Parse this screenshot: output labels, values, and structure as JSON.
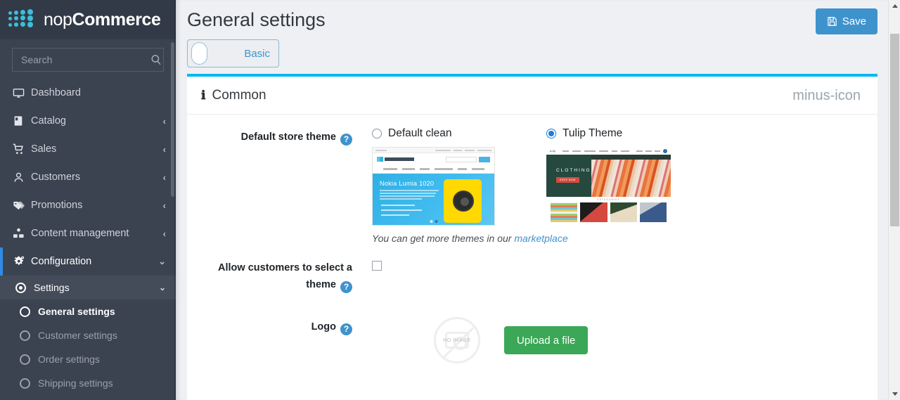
{
  "brand": {
    "name_light": "nop",
    "name_bold": "Commerce",
    "logo_icon": "nopcommerce-dots-logo"
  },
  "search": {
    "placeholder": "Search",
    "value": "",
    "icon": "search-icon"
  },
  "sidebar": {
    "items": [
      {
        "label": "Dashboard",
        "icon": "monitor-icon",
        "caret": ""
      },
      {
        "label": "Catalog",
        "icon": "book-icon",
        "caret": "‹"
      },
      {
        "label": "Sales",
        "icon": "shopping-cart-icon",
        "caret": "‹"
      },
      {
        "label": "Customers",
        "icon": "user-icon",
        "caret": "‹"
      },
      {
        "label": "Promotions",
        "icon": "tags-icon",
        "caret": "‹"
      },
      {
        "label": "Content management",
        "icon": "content-blocks-icon",
        "caret": "‹"
      },
      {
        "label": "Configuration",
        "icon": "gears-icon",
        "caret": "⌄"
      }
    ],
    "settings": {
      "label": "Settings",
      "icon": "radio-selected-icon",
      "caret": "⌄"
    },
    "settings_children": [
      {
        "label": "General settings",
        "icon": "circle-icon",
        "current": true
      },
      {
        "label": "Customer settings",
        "icon": "circle-icon",
        "current": false
      },
      {
        "label": "Order settings",
        "icon": "circle-icon",
        "current": false
      },
      {
        "label": "Shipping settings",
        "icon": "circle-icon",
        "current": false
      }
    ]
  },
  "header": {
    "title": "General settings",
    "save_label": "Save",
    "save_icon": "floppy-disk-icon",
    "save_color": "#3f93cd"
  },
  "mode_toggle": {
    "label": "Basic",
    "state": "off",
    "accent": "#3f93cd"
  },
  "panel": {
    "title": "Common",
    "title_icon": "info-icon",
    "collapse_icon": "minus-icon",
    "accent": "#00b9f1"
  },
  "form": {
    "default_store_theme": {
      "label": "Default store theme",
      "hint_icon": "question-mark-icon",
      "options": [
        {
          "name": "Default clean",
          "selected": false,
          "preview": "nokia-lumia-1020-storefront-preview"
        },
        {
          "name": "Tulip Theme",
          "selected": true,
          "preview": "clothing-storefront-preview"
        }
      ],
      "note_text": "You can get more themes in our ",
      "note_link": "marketplace"
    },
    "allow_select_theme": {
      "label": "Allow customers to select a theme",
      "hint_icon": "question-mark-icon",
      "checked": false
    },
    "logo": {
      "label": "Logo",
      "hint_icon": "question-mark-icon",
      "placeholder_text": "NO IMAGE",
      "placeholder_icon": "no-image-camera-icon",
      "upload_label": "Upload a file",
      "upload_color": "#3aa856"
    }
  },
  "preview_default_clean": {
    "hero_title": "Nokia Lumia 1020",
    "logo_text": "nopCommerce"
  },
  "preview_tulip": {
    "logo_text": "tulip",
    "hero_caption": "CLOTHING",
    "hero_button": "SHOP NOW",
    "categories_title": "CATEGORIES"
  },
  "scrollbar": {
    "up_icon": "scroll-up-arrow-icon",
    "down_icon": "scroll-down-arrow-icon"
  }
}
